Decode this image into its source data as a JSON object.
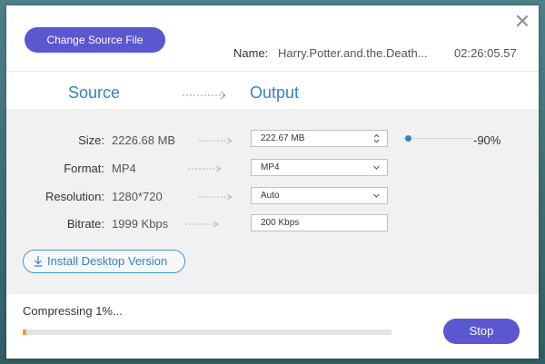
{
  "dialog": {
    "change_source_label": "Change Source File",
    "name_label": "Name:",
    "name_value": "Harry.Potter.and.the.Death...",
    "duration": "02:26:05.57"
  },
  "headers": {
    "source": "Source",
    "output": "Output"
  },
  "rows": [
    {
      "label": "Size:",
      "source": "2226.68  MB",
      "output": "222.67  MB",
      "control": "stepper"
    },
    {
      "label": "Format:",
      "source": "MP4",
      "output": "MP4",
      "control": "dropdown"
    },
    {
      "label": "Resolution:",
      "source": "1280*720",
      "output": "Auto",
      "control": "dropdown"
    },
    {
      "label": "Bitrate:",
      "source": "1999  Kbps",
      "output": "200 Kbps",
      "control": "text"
    }
  ],
  "compression_slider": {
    "percent_label": "-90%",
    "level": 0.1
  },
  "install_label": "Install Desktop Version",
  "status": {
    "text": "Compressing 1%...",
    "progress": 0.01
  },
  "stop_label": "Stop",
  "colors": {
    "accent": "#5b57d1",
    "link": "#2e86c1",
    "progress": "#f0a020"
  }
}
